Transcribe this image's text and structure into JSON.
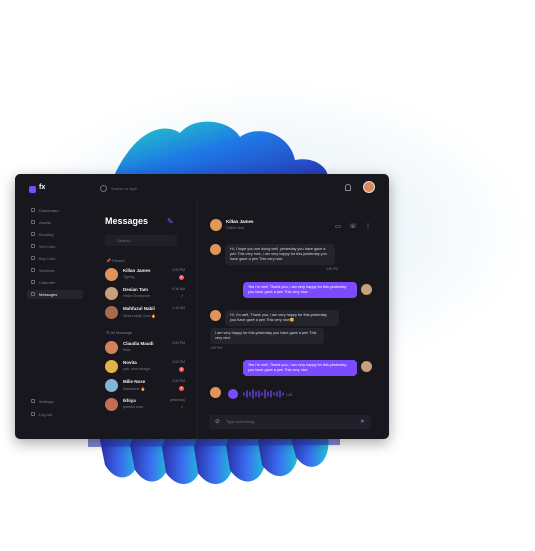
{
  "app": {
    "logo_text": "fx"
  },
  "search": {
    "placeholder": "Search or type"
  },
  "sidebar": {
    "items": [
      {
        "label": "Dashboard"
      },
      {
        "label": "Assets"
      },
      {
        "label": "Booking"
      },
      {
        "label": "Sell Cars"
      },
      {
        "label": "Buy Cars"
      },
      {
        "label": "Services"
      },
      {
        "label": "Calender"
      },
      {
        "label": "Messages",
        "active": true
      }
    ],
    "bottom": [
      {
        "label": "Settings"
      },
      {
        "label": "Log out"
      }
    ]
  },
  "messages": {
    "title": "Messages",
    "search_placeholder": "Search...",
    "pinned_label": "Pinned",
    "all_label": "All Message",
    "pinned": [
      {
        "name": "Killan James",
        "preview": "Typing...",
        "time": "4:30 PM",
        "badge": "2"
      },
      {
        "name": "Desian Tam",
        "preview": "Hello! Everyone",
        "time": "9:36 AM",
        "tick": "✓"
      },
      {
        "name": "Mahfuzul Nabil",
        "preview": "Wow really Cool 🔥",
        "time": "1:15 AM"
      }
    ],
    "all": [
      {
        "name": "Claudia Maudi",
        "preview": "Nice",
        "time": "4:30 PM"
      },
      {
        "name": "Novita",
        "preview": "yah, nice design",
        "time": "4:30 PM",
        "badge": "2"
      },
      {
        "name": "Milie Nose",
        "preview": "Awesome 🔥",
        "time": "4:30 PM",
        "badge": "1"
      },
      {
        "name": "Ikhiya",
        "preview": "publish now",
        "time": "yesterday",
        "tick": "✓"
      }
    ]
  },
  "chat": {
    "contact_name": "Killan James",
    "contact_status": "Online Now",
    "messages": [
      {
        "dir": "in",
        "text": "Hi, I hope you are doing well, yesterday you have gave a pen This very nice, i am very happy for this.yesterday you have gave a pen This very nice",
        "time": "4:30 PM"
      },
      {
        "dir": "out",
        "text": "Yes I'm well, Thank you, i am very happy for this.yesterday you have gave a pen This very nice"
      },
      {
        "dir": "in",
        "text": "Hi, I'm well, Thank you, i am very happy for this.yesterday you have gave a pen This very nice😊"
      },
      {
        "dir": "in",
        "text": "I am very happy for this.yesterday you have gave a pen This very nice",
        "time": "4:30 PM"
      },
      {
        "dir": "out",
        "text": "Yes I'm well, Thank you, i am very happy for this.yesterday you have gave a pen This very nice"
      }
    ],
    "voice_time": "1:05",
    "input_placeholder": "Type something..."
  },
  "colors": {
    "accent": "#7b4cff",
    "bg": "#17171d",
    "panel": "#24242c"
  }
}
